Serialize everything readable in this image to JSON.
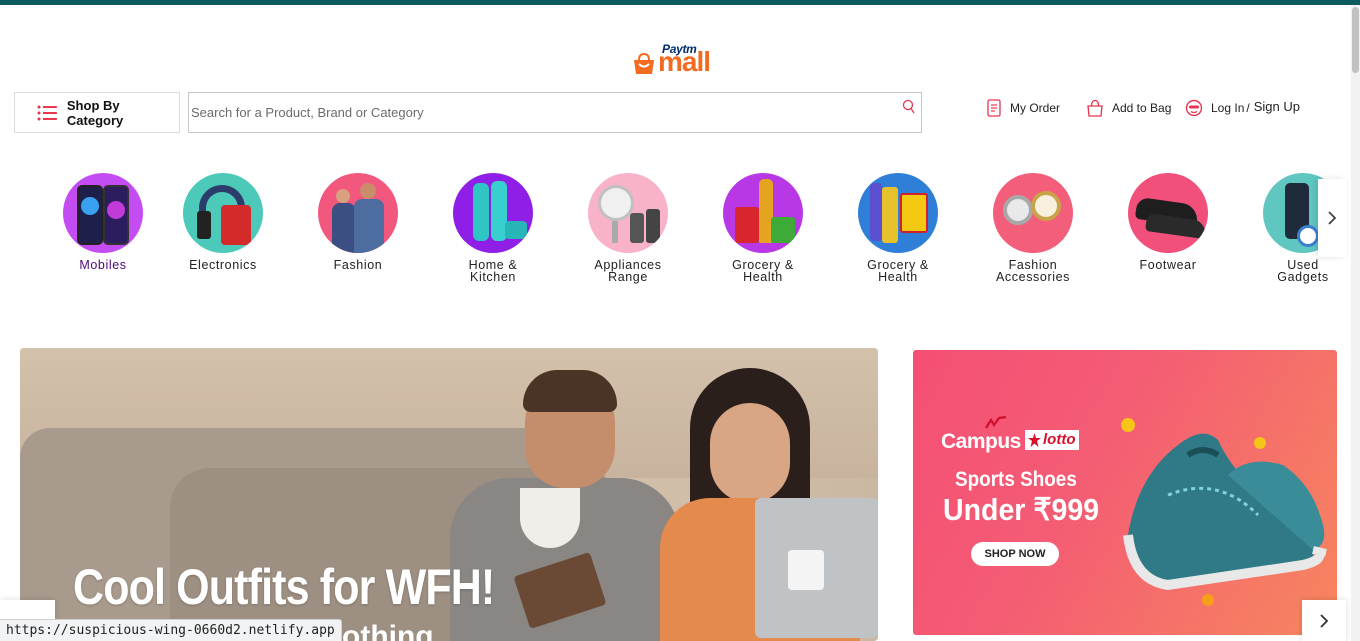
{
  "header": {
    "logo": {
      "brand_top": "Paytm",
      "brand_main": "mall"
    },
    "category_button": "Shop By Category",
    "search": {
      "placeholder": "Search for a Product, Brand or Category",
      "value": ""
    },
    "links": {
      "order": "My Order",
      "bag": "Add to Bag",
      "login": "Log In",
      "separator": "/",
      "signup": "Sign Up"
    }
  },
  "categories": [
    {
      "label": "Mobiles",
      "icon": "mobiles-icon",
      "active": true
    },
    {
      "label": "Electronics",
      "icon": "electronics-icon"
    },
    {
      "label": "Fashion",
      "icon": "fashion-icon"
    },
    {
      "label": "Home &",
      "label2": "Kitchen",
      "icon": "home-kitchen-icon"
    },
    {
      "label": "Appliances",
      "label2": "Range",
      "icon": "appliances-icon"
    },
    {
      "label": "Grocery &",
      "label2": "Health",
      "icon": "grocery-health-icon"
    },
    {
      "label": "Grocery &",
      "label2": "Health",
      "icon": "grocery-health-icon"
    },
    {
      "label": "Fashion",
      "label2": "Accessories",
      "icon": "fashion-accessories-icon"
    },
    {
      "label": "Footwear",
      "icon": "footwear-icon"
    },
    {
      "label": "Used",
      "label2": "Gadgets",
      "icon": "used-gadgets-icon"
    }
  ],
  "banners": {
    "main": {
      "headline": "Cool Outfits for WFH!",
      "sub": "Clothing"
    },
    "side": {
      "brand1": "Campus",
      "brand2": "lotto",
      "line1": "Sports Shoes",
      "line2": "Under ₹999",
      "button": "SHOP NOW"
    }
  },
  "status_bar": {
    "url": "https://suspicious-wing-0660d2.netlify.app"
  },
  "colors": {
    "accent": "#f26b21",
    "brand_blue": "#002e6e",
    "active_category": "#4b0a7a",
    "top_bar": "#0b5a5e",
    "icon_red": "#e8344e"
  }
}
